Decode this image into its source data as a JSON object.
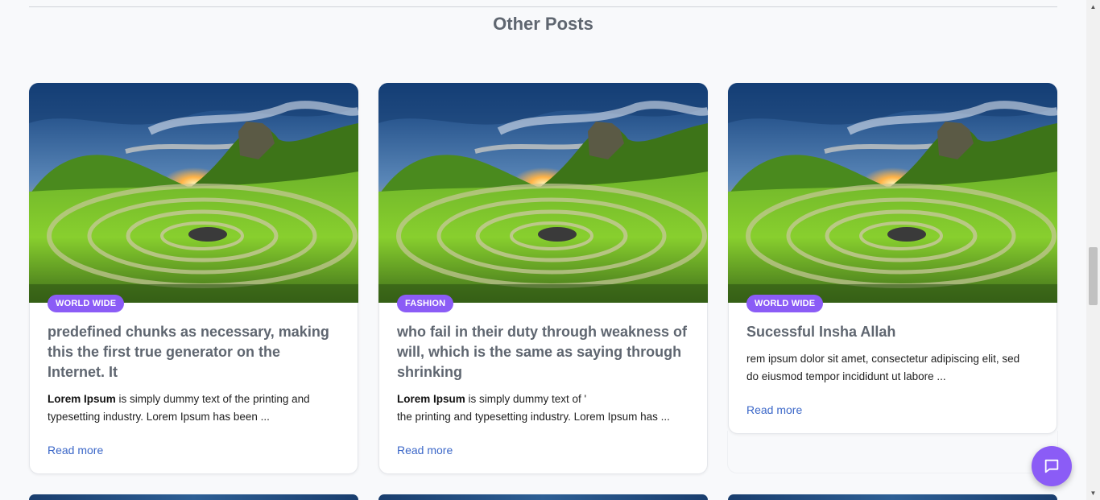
{
  "section": {
    "title": "Other Posts"
  },
  "posts": [
    {
      "badge": "WORLD WIDE",
      "title": "predefined chunks as necessary, making this the first true generator on the Internet. It",
      "excerpt_bold": "Lorem Ipsum",
      "excerpt_line1": " is simply dummy text of the printing and",
      "excerpt_line2": "typesetting industry. Lorem Ipsum has been ...",
      "read_more": "Read more"
    },
    {
      "badge": "FASHION",
      "title": "who fail in their duty through weakness of will, which is the same as saying through shrinking",
      "excerpt_bold": "Lorem Ipsum",
      "excerpt_line1": " is simply dummy text of '",
      "excerpt_line2": "the printing and typesetting industry. Lorem Ipsum has ...",
      "read_more": "Read more"
    },
    {
      "badge": "WORLD WIDE",
      "title": "Sucessful Insha Allah",
      "excerpt_line1": "rem ipsum dolor sit amet, consectetur adipiscing elit, sed",
      "excerpt_line2": "do eiusmod tempor incididunt ut labore ...",
      "read_more": "Read more"
    }
  ],
  "colors": {
    "accent": "#8b5cf6",
    "link": "#3b67c8",
    "title": "#5f6670"
  },
  "icons": {
    "chat": "chat-bubble-icon"
  }
}
